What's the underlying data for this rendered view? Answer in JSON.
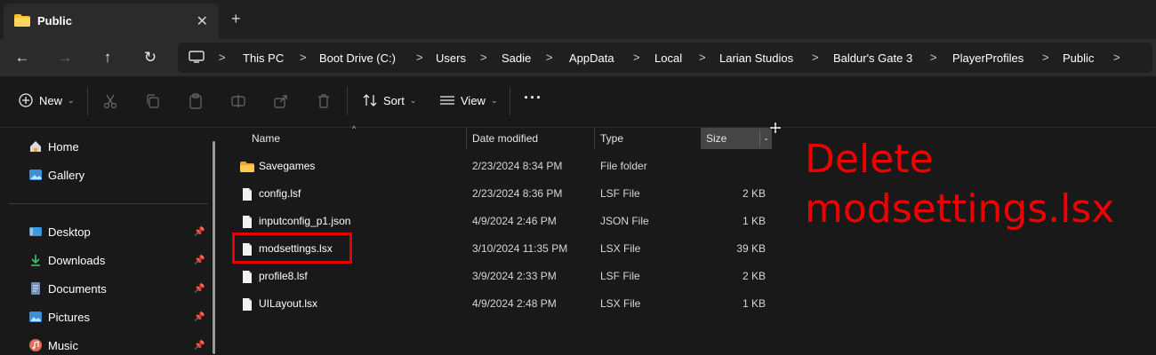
{
  "tab": {
    "title": "Public",
    "close": "✕",
    "new_tab": "+"
  },
  "nav": {
    "back": "←",
    "forward": "→",
    "up": "↑",
    "refresh": "↻"
  },
  "breadcrumbs": [
    "This PC",
    "Boot Drive (C:)",
    "Users",
    "Sadie",
    "AppData",
    "Local",
    "Larian Studios",
    "Baldur's Gate 3",
    "PlayerProfiles",
    "Public"
  ],
  "separator": ">",
  "toolbar": {
    "new_label": "New",
    "sort_label": "Sort",
    "view_label": "View",
    "more": "···",
    "chevron": "⌄"
  },
  "sidebar": {
    "items": [
      {
        "label": "Home",
        "icon": "home-icon",
        "pinned": false
      },
      {
        "label": "Gallery",
        "icon": "gallery-icon",
        "pinned": false
      },
      {
        "label": "Desktop",
        "icon": "desktop-icon",
        "pinned": true
      },
      {
        "label": "Downloads",
        "icon": "downloads-icon",
        "pinned": true
      },
      {
        "label": "Documents",
        "icon": "documents-icon",
        "pinned": true
      },
      {
        "label": "Pictures",
        "icon": "pictures-icon",
        "pinned": true
      },
      {
        "label": "Music",
        "icon": "music-icon",
        "pinned": true
      }
    ],
    "pin_glyph": "📌"
  },
  "columns": {
    "name": "Name",
    "date": "Date modified",
    "type": "Type",
    "size": "Size",
    "sort_caret": "^",
    "dropdown": "⌄"
  },
  "files": [
    {
      "name": "Savegames",
      "date": "2/23/2024 8:34 PM",
      "type": "File folder",
      "size": "",
      "icon": "folder-icon"
    },
    {
      "name": "config.lsf",
      "date": "2/23/2024 8:36 PM",
      "type": "LSF File",
      "size": "2 KB",
      "icon": "file-icon"
    },
    {
      "name": "inputconfig_p1.json",
      "date": "4/9/2024 2:46 PM",
      "type": "JSON File",
      "size": "1 KB",
      "icon": "file-icon"
    },
    {
      "name": "modsettings.lsx",
      "date": "3/10/2024 11:35 PM",
      "type": "LSX File",
      "size": "39 KB",
      "icon": "file-icon"
    },
    {
      "name": "profile8.lsf",
      "date": "3/9/2024 2:33 PM",
      "type": "LSF File",
      "size": "2 KB",
      "icon": "file-icon"
    },
    {
      "name": "UILayout.lsx",
      "date": "4/9/2024 2:48 PM",
      "type": "LSX File",
      "size": "1 KB",
      "icon": "file-icon"
    }
  ],
  "annotation": {
    "line1": "Delete",
    "line2": "modsettings.lsx",
    "color": "#ee0000"
  },
  "colors": {
    "folder": "#f4c430",
    "highlight": "#e60000",
    "background": "#191919"
  }
}
